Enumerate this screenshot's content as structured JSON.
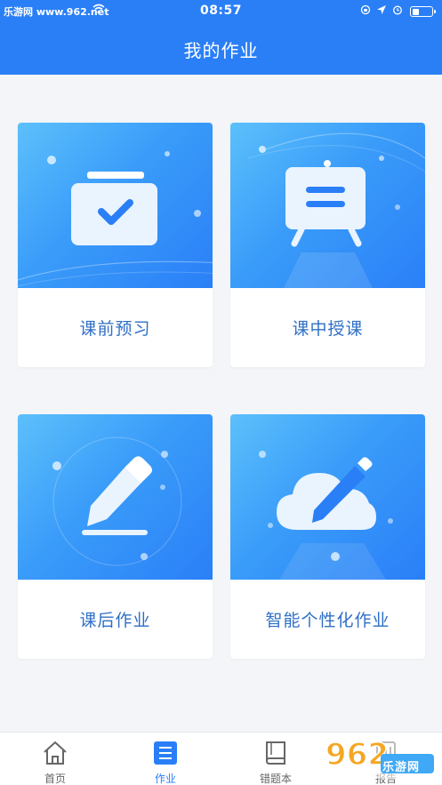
{
  "status_bar": {
    "watermark": "乐游网 www.962.net",
    "time": "08:57",
    "icons": [
      "wifi-icon",
      "orientation-lock-icon",
      "location-icon",
      "alarm-icon",
      "battery-icon"
    ]
  },
  "nav": {
    "title": "我的作业"
  },
  "cards": [
    {
      "label": "课前预习",
      "icon": "briefcase-check-icon"
    },
    {
      "label": "课中授课",
      "icon": "easel-board-icon"
    },
    {
      "label": "课后作业",
      "icon": "pencil-icon"
    },
    {
      "label": "智能个性化作业",
      "icon": "cloud-pencil-icon"
    }
  ],
  "tabs": [
    {
      "label": "首页",
      "icon": "home-icon"
    },
    {
      "label": "作业",
      "icon": "homework-list-icon",
      "active": true
    },
    {
      "label": "错题本",
      "icon": "book-icon"
    },
    {
      "label": "报告",
      "icon": "report-icon"
    }
  ],
  "overlay_watermark": {
    "brand": "962",
    "text": "乐游网"
  },
  "colors": {
    "primary": "#2a7ff7",
    "label": "#2f6fc6",
    "background": "#f3f5f8",
    "tab_inactive": "#666666"
  }
}
